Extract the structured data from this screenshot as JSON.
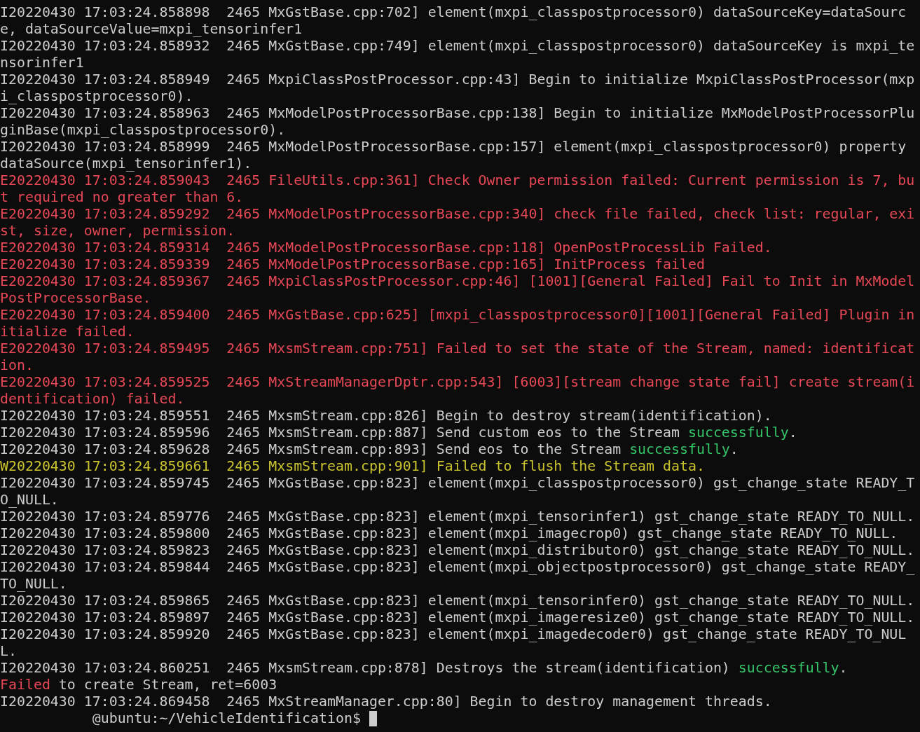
{
  "terminal": {
    "lines": [
      {
        "segments": [
          {
            "kind": "normal",
            "text": "I20220430 17:03:24.858898  2465 MxGstBase.cpp:702] element(mxpi_classpostprocessor0) dataSourceKey=dataSource, dataSourceValue=mxpi_tensorinfer1"
          }
        ]
      },
      {
        "segments": [
          {
            "kind": "normal",
            "text": "I20220430 17:03:24.858932  2465 MxGstBase.cpp:749] element(mxpi_classpostprocessor0) dataSourceKey is mxpi_tensorinfer1"
          }
        ]
      },
      {
        "segments": [
          {
            "kind": "normal",
            "text": "I20220430 17:03:24.858949  2465 MxpiClassPostProcessor.cpp:43] Begin to initialize MxpiClassPostProcessor(mxpi_classpostprocessor0)."
          }
        ]
      },
      {
        "segments": [
          {
            "kind": "normal",
            "text": "I20220430 17:03:24.858963  2465 MxModelPostProcessorBase.cpp:138] Begin to initialize MxModelPostProcessorPluginBase(mxpi_classpostprocessor0)."
          }
        ]
      },
      {
        "segments": [
          {
            "kind": "normal",
            "text": "I20220430 17:03:24.858999  2465 MxModelPostProcessorBase.cpp:157] element(mxpi_classpostprocessor0) property dataSource(mxpi_tensorinfer1)."
          }
        ]
      },
      {
        "segments": [
          {
            "kind": "error",
            "text": "E20220430 17:03:24.859043  2465 FileUtils.cpp:361] Check Owner permission failed: Current permission is 7, but required no greater than 6."
          }
        ]
      },
      {
        "segments": [
          {
            "kind": "error",
            "text": "E20220430 17:03:24.859292  2465 MxModelPostProcessorBase.cpp:340] check file failed, check list: regular, exist, size, owner, permission."
          }
        ]
      },
      {
        "segments": [
          {
            "kind": "error",
            "text": "E20220430 17:03:24.859314  2465 MxModelPostProcessorBase.cpp:118] OpenPostProcessLib Failed."
          }
        ]
      },
      {
        "segments": [
          {
            "kind": "error",
            "text": "E20220430 17:03:24.859339  2465 MxModelPostProcessorBase.cpp:165] InitProcess failed"
          }
        ]
      },
      {
        "segments": [
          {
            "kind": "error",
            "text": "E20220430 17:03:24.859367  2465 MxpiClassPostProcessor.cpp:46] [1001][General Failed] Fail to Init in MxModelPostProcessorBase."
          }
        ]
      },
      {
        "segments": [
          {
            "kind": "error",
            "text": "E20220430 17:03:24.859400  2465 MxGstBase.cpp:625] [mxpi_classpostprocessor0][1001][General Failed] Plugin initialize failed."
          }
        ]
      },
      {
        "segments": [
          {
            "kind": "error",
            "text": "E20220430 17:03:24.859495  2465 MxsmStream.cpp:751] Failed to set the state of the Stream, named: identification."
          }
        ]
      },
      {
        "segments": [
          {
            "kind": "error",
            "text": "E20220430 17:03:24.859525  2465 MxStreamManagerDptr.cpp:543] [6003][stream change state fail] create stream(identification) failed."
          }
        ]
      },
      {
        "segments": [
          {
            "kind": "normal",
            "text": "I20220430 17:03:24.859551  2465 MxsmStream.cpp:826] Begin to destroy stream(identification)."
          }
        ]
      },
      {
        "segments": [
          {
            "kind": "normal",
            "text": "I20220430 17:03:24.859596  2465 MxsmStream.cpp:887] Send custom eos to the Stream "
          },
          {
            "kind": "success",
            "text": "successfully"
          },
          {
            "kind": "normal",
            "text": "."
          }
        ]
      },
      {
        "segments": [
          {
            "kind": "normal",
            "text": "I20220430 17:03:24.859628  2465 MxsmStream.cpp:893] Send eos to the Stream "
          },
          {
            "kind": "success",
            "text": "successfully"
          },
          {
            "kind": "normal",
            "text": "."
          }
        ]
      },
      {
        "segments": [
          {
            "kind": "warning",
            "text": "W20220430 17:03:24.859661  2465 MxsmStream.cpp:901] Failed to flush the Stream data."
          }
        ]
      },
      {
        "segments": [
          {
            "kind": "normal",
            "text": "I20220430 17:03:24.859745  2465 MxGstBase.cpp:823] element(mxpi_classpostprocessor0) gst_change_state READY_TO_NULL."
          }
        ]
      },
      {
        "segments": [
          {
            "kind": "normal",
            "text": "I20220430 17:03:24.859776  2465 MxGstBase.cpp:823] element(mxpi_tensorinfer1) gst_change_state READY_TO_NULL."
          }
        ]
      },
      {
        "segments": [
          {
            "kind": "normal",
            "text": "I20220430 17:03:24.859800  2465 MxGstBase.cpp:823] element(mxpi_imagecrop0) gst_change_state READY_TO_NULL."
          }
        ]
      },
      {
        "segments": [
          {
            "kind": "normal",
            "text": "I20220430 17:03:24.859823  2465 MxGstBase.cpp:823] element(mxpi_distributor0) gst_change_state READY_TO_NULL."
          }
        ]
      },
      {
        "segments": [
          {
            "kind": "normal",
            "text": "I20220430 17:03:24.859844  2465 MxGstBase.cpp:823] element(mxpi_objectpostprocessor0) gst_change_state READY_TO_NULL."
          }
        ]
      },
      {
        "segments": [
          {
            "kind": "normal",
            "text": "I20220430 17:03:24.859865  2465 MxGstBase.cpp:823] element(mxpi_tensorinfer0) gst_change_state READY_TO_NULL."
          }
        ]
      },
      {
        "segments": [
          {
            "kind": "normal",
            "text": "I20220430 17:03:24.859897  2465 MxGstBase.cpp:823] element(mxpi_imageresize0) gst_change_state READY_TO_NULL."
          }
        ]
      },
      {
        "segments": [
          {
            "kind": "normal",
            "text": "I20220430 17:03:24.859920  2465 MxGstBase.cpp:823] element(mxpi_imagedecoder0) gst_change_state READY_TO_NULL."
          }
        ]
      },
      {
        "segments": [
          {
            "kind": "normal",
            "text": "I20220430 17:03:24.860251  2465 MxsmStream.cpp:878] Destroys the stream(identification) "
          },
          {
            "kind": "success",
            "text": "successfully"
          },
          {
            "kind": "normal",
            "text": "."
          }
        ]
      },
      {
        "segments": [
          {
            "kind": "error",
            "text": "Failed"
          },
          {
            "kind": "normal",
            "text": " to create Stream, ret=6003"
          }
        ]
      },
      {
        "segments": [
          {
            "kind": "normal",
            "text": "I20220430 17:03:24.869458  2465 MxStreamManager.cpp:80] Begin to destroy management threads."
          }
        ]
      }
    ],
    "prompt": "@ubuntu:~/VehicleIdentification$"
  }
}
